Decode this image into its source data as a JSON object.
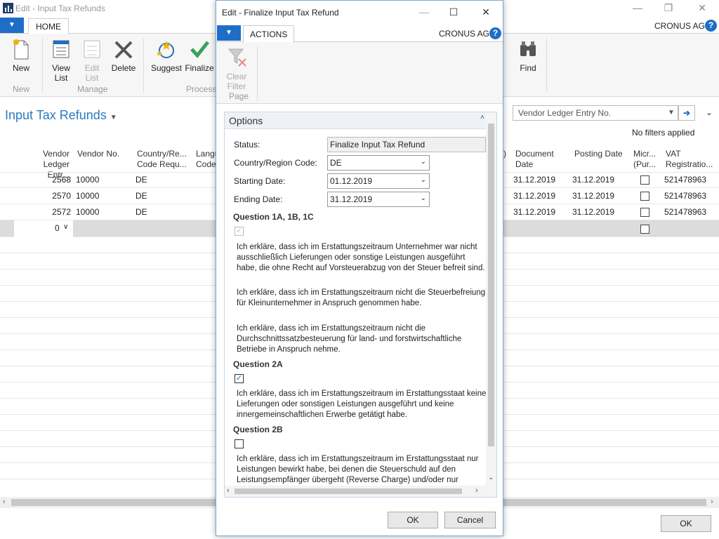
{
  "app": {
    "title": "Edit - Input Tax Refunds",
    "company": "CRONUS AG",
    "tab_home": "HOME"
  },
  "ribbon": {
    "new": "New",
    "view_list": [
      "View",
      "List"
    ],
    "edit_list": [
      "Edit",
      "List"
    ],
    "delete": "Delete",
    "suggest": "Suggest",
    "finalize": "Finalize",
    "find": "Find",
    "groups": {
      "new": "New",
      "manage": "Manage",
      "process": "Process"
    }
  },
  "page": {
    "title": "Input Tax Refunds",
    "search_field": "Vendor Ledger Entry No.",
    "filters": "No filters applied"
  },
  "columns": {
    "vendor_ledger": [
      "Vendor",
      "Ledger Entr..."
    ],
    "vendor_no": "Vendor No.",
    "country": [
      "Country/Re...",
      "Code Requ..."
    ],
    "language": [
      "Langu",
      "Code"
    ],
    "doc_date": [
      "Document",
      "Date"
    ],
    "posting_date": "Posting Date",
    "micro": [
      "Micr...",
      "(Pur..."
    ],
    "vat": [
      "VAT",
      "Registratio..."
    ],
    "paren": ")"
  },
  "rows": [
    {
      "entry": "2568",
      "vendor": "10000",
      "country": "DE",
      "doc_date": "31.12.2019",
      "posting_date": "31.12.2019",
      "vat": "521478963"
    },
    {
      "entry": "2570",
      "vendor": "10000",
      "country": "DE",
      "doc_date": "31.12.2019",
      "posting_date": "31.12.2019",
      "vat": "521478963"
    },
    {
      "entry": "2572",
      "vendor": "10000",
      "country": "DE",
      "doc_date": "31.12.2019",
      "posting_date": "31.12.2019",
      "vat": "521478963"
    }
  ],
  "new_row": {
    "entry": "0"
  },
  "main_ok": "OK",
  "dialog": {
    "title": "Edit - Finalize Input Tax Refund",
    "tab_actions": "ACTIONS",
    "company": "CRONUS AG",
    "clear_filter": [
      "Clear",
      "Filter"
    ],
    "group_page": "Page",
    "section": "Options",
    "status_label": "Status:",
    "status_value": "Finalize Input Tax Refund",
    "country_label": "Country/Region Code:",
    "country_value": "DE",
    "start_label": "Starting Date:",
    "start_value": "01.12.2019",
    "end_label": "Ending Date:",
    "end_value": "31.12.2019",
    "q1_heading": "Question 1A, 1B, 1C",
    "q1_text1": "Ich erkläre, dass ich im Erstattungszeitraum Unternehmer war nicht ausschließlich Lieferungen oder sonstige Leistungen ausgeführt habe, die ohne Recht auf Vorsteuerabzug von der Steuer befreit sind.",
    "q1_text2": "Ich erkläre, dass ich im Erstattungszeitraum nicht die Steuerbefreiung für Kleinunternehmer in Anspruch genommen habe.",
    "q1_text3": "Ich erkläre, dass ich im Erstattungszeitraum nicht die Durchschnittssatzbesteuerung für land- und forstwirtschaftliche Betriebe in Anspruch nehme.",
    "q2a_heading": "Question 2A",
    "q2a_text": "Ich erkläre, dass ich im Erstattungszeitraum im Erstattungsstaat keine Lieferungen oder sonstigen Leistungen ausgeführt und keine innergemeinschaftlichen Erwerbe getätigt habe.",
    "q2b_heading": "Question 2B",
    "q2b_text": "Ich erkläre, dass ich im Erstattungszeitraum im Erstattungsstaat nur Leistungen bewirkt habe, bei denen die Steuerschuld auf den Leistungsempfänger übergeht (Reverse Charge) und/oder nur",
    "ok": "OK",
    "cancel": "Cancel"
  },
  "colors": {
    "accent": "#1e6ec8",
    "title_blue": "#2b79c1"
  }
}
